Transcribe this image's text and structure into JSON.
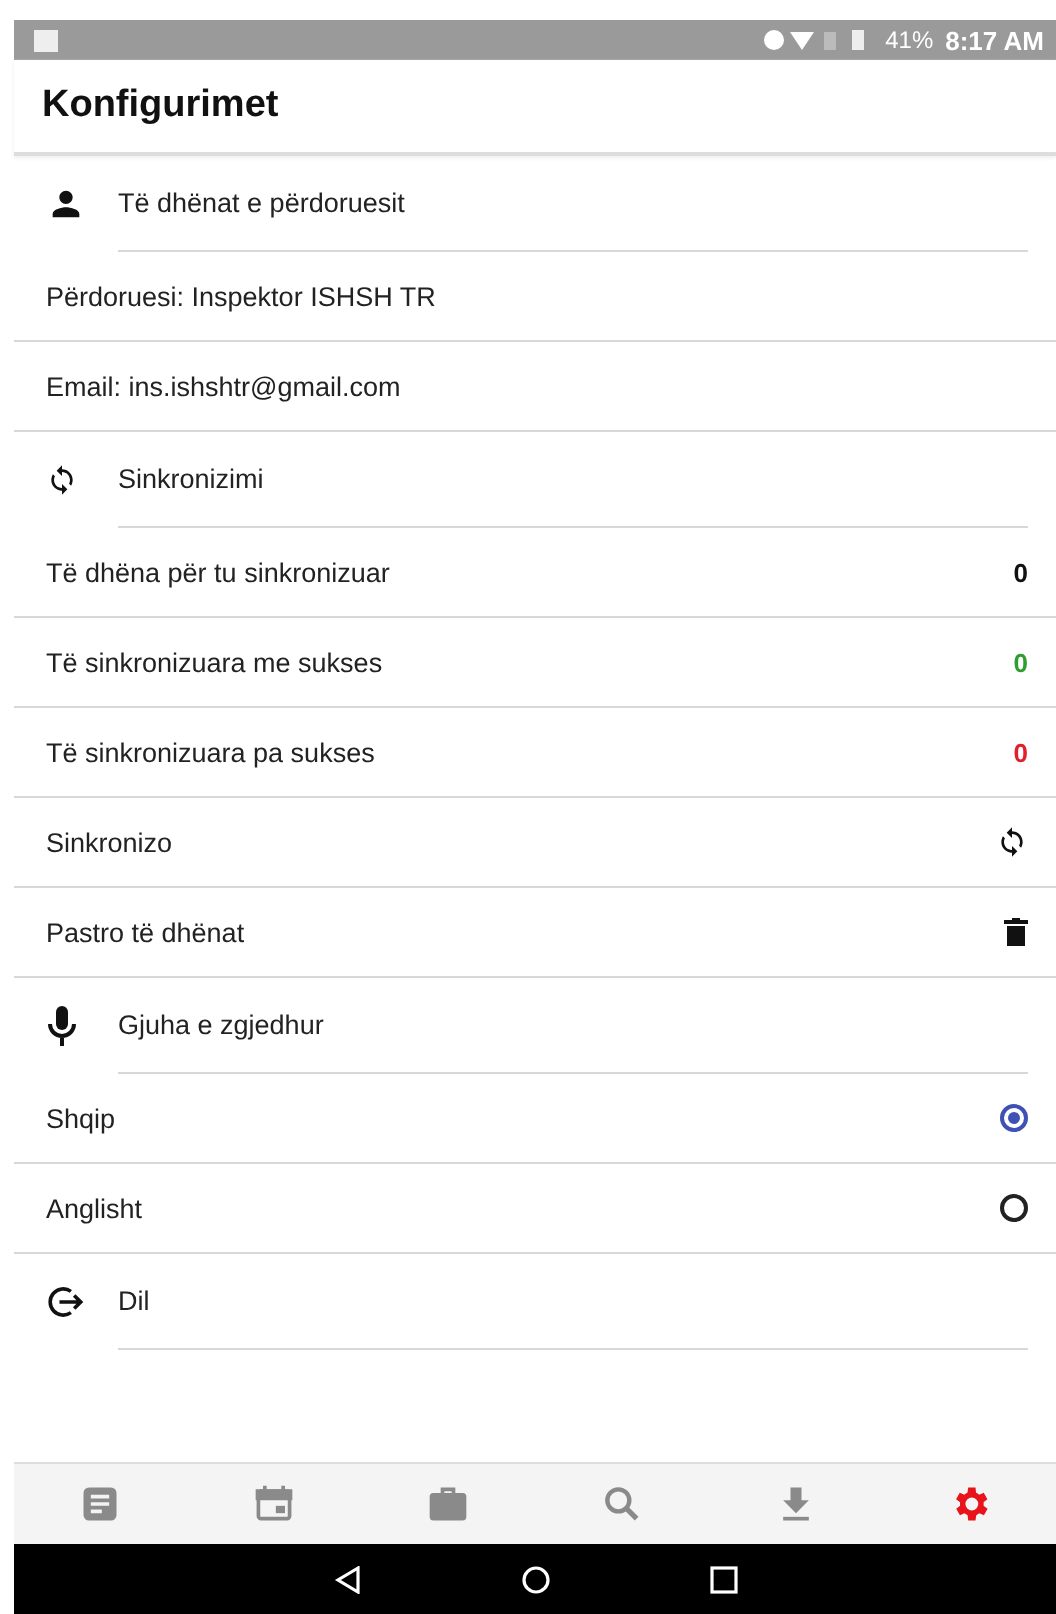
{
  "status_bar": {
    "battery": "41%",
    "time": "8:17 AM"
  },
  "app_bar": {
    "title": "Konfigurimet"
  },
  "rows": [
    {
      "kind": "section",
      "label": "Të dhënat e përdoruesit"
    },
    {
      "kind": "info",
      "label": "Përdoruesi:  Inspektor  ISHSH TR"
    },
    {
      "kind": "info",
      "label": "Email: ins.ishshtr@gmail.com"
    },
    {
      "kind": "section",
      "label": "Sinkronizimi"
    },
    {
      "kind": "count",
      "label": "Të dhëna për tu sinkronizuar",
      "value": "0",
      "color": "#111111"
    },
    {
      "kind": "count",
      "label": "Të sinkronizuara me sukses",
      "value": "0",
      "color": "#2e9e2e"
    },
    {
      "kind": "count",
      "label": "Të sinkronizuara pa sukses",
      "value": "0",
      "color": "#e0202a"
    },
    {
      "kind": "sync",
      "label": "Sinkronizo"
    },
    {
      "kind": "delete",
      "label": "Pastro të dhënat"
    },
    {
      "kind": "section",
      "label": "Gjuha e zgjedhur"
    },
    {
      "kind": "radio",
      "label": "Shqip",
      "selected": true
    },
    {
      "kind": "radio",
      "label": "Anglisht",
      "selected": false
    },
    {
      "kind": "logout",
      "label": "Dil"
    }
  ],
  "bottom_nav": [
    {
      "selected": false
    },
    {
      "selected": false
    },
    {
      "selected": false
    },
    {
      "selected": false
    },
    {
      "selected": false
    },
    {
      "selected": true
    }
  ]
}
